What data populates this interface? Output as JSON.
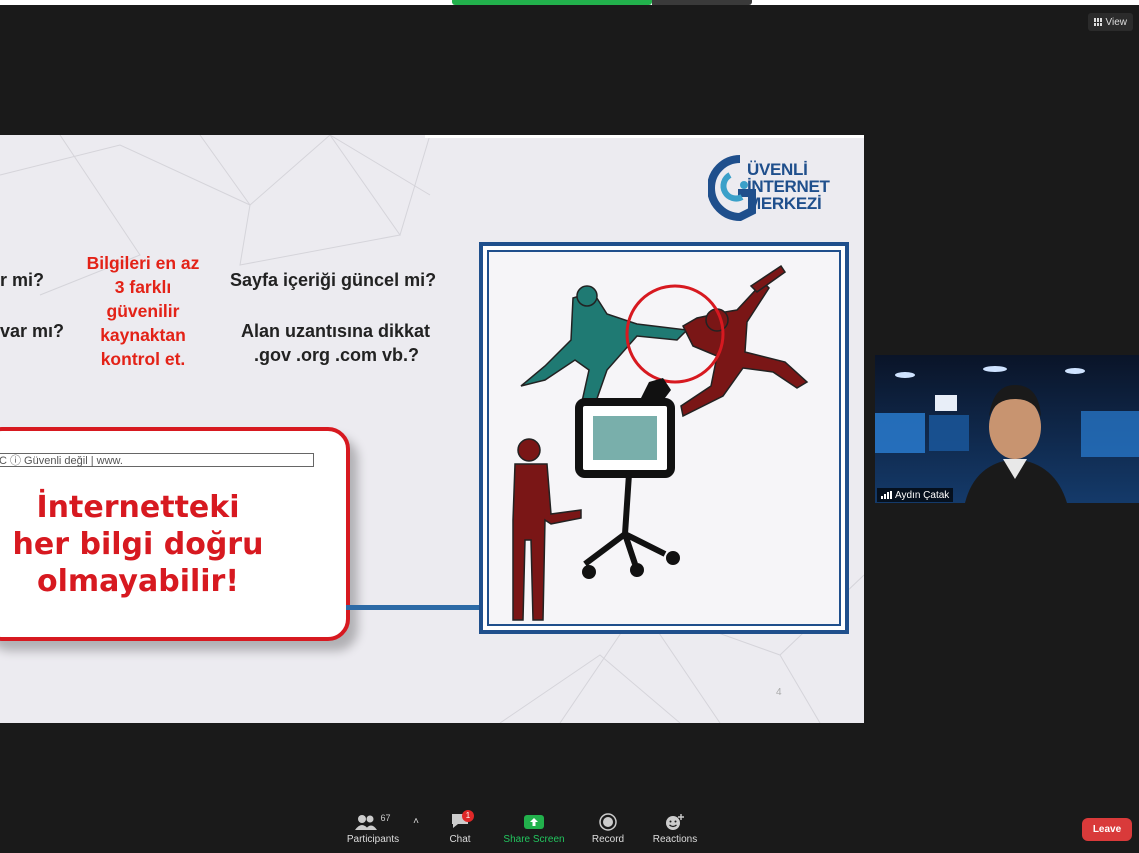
{
  "window": {
    "view_label": "View"
  },
  "slide": {
    "logo": {
      "line1": "ÜVENLİ",
      "line2": "İNTERNET",
      "line3": "MERKEZİ"
    },
    "left_q1": "r mi?",
    "left_q2": "var mı?",
    "mid_lines": [
      "Bilgileri en az",
      "3 farklı",
      "güvenilir",
      "kaynaktan",
      "kontrol et."
    ],
    "right_q1": "Sayfa içeriği güncel mi?",
    "right_q2_line1": "Alan uzantısına dikkat",
    "right_q2_line2": ".gov .org .com vb.?",
    "url_text": "C   ⓘ Güvenli değil | www.",
    "card_lines": [
      "İnternetteki",
      "her bilgi doğru",
      "olmayabilir!"
    ],
    "page_number": "4"
  },
  "video": {
    "participant_name": "Aydın Çatak"
  },
  "toolbar": {
    "participants_label": "Participants",
    "participants_count": "67",
    "chat_label": "Chat",
    "chat_badge": "1",
    "share_label": "Share Screen",
    "record_label": "Record",
    "reactions_label": "Reactions",
    "leave_label": "Leave"
  },
  "colors": {
    "accent_red": "#d71920",
    "brand_blue": "#1f4f8c",
    "share_green": "#22b14c",
    "leave_red": "#d93a3a"
  }
}
